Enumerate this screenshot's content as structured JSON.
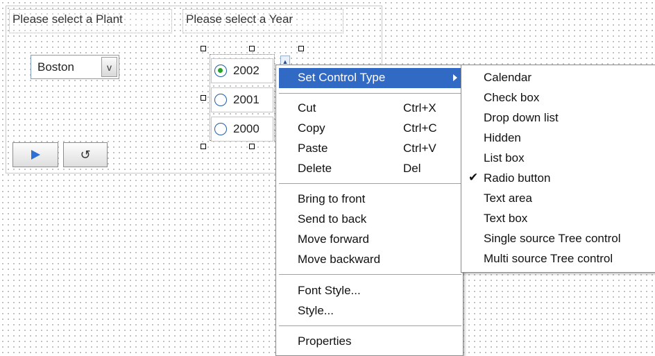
{
  "prompts": {
    "plant_label": "Please select a Plant",
    "year_label": "Please select a Year",
    "plant_select": {
      "value": "Boston",
      "arrow": "v"
    },
    "year_options": [
      {
        "label": "2002",
        "checked": true
      },
      {
        "label": "2001",
        "checked": false
      },
      {
        "label": "2000",
        "checked": false
      }
    ],
    "run_icon": "play-icon",
    "reset_icon": "reset-icon",
    "reset_glyph": "↺"
  },
  "context_menu": {
    "items": [
      {
        "label": "Set Control Type",
        "shortcut": "",
        "submenu": true,
        "highlighted": true
      },
      {
        "label": "Cut",
        "shortcut": "Ctrl+X"
      },
      {
        "label": "Copy",
        "shortcut": "Ctrl+C"
      },
      {
        "label": "Paste",
        "shortcut": "Ctrl+V"
      },
      {
        "label": "Delete",
        "shortcut": "Del"
      },
      {
        "label": "Bring to front",
        "shortcut": ""
      },
      {
        "label": "Send to back",
        "shortcut": ""
      },
      {
        "label": "Move forward",
        "shortcut": ""
      },
      {
        "label": "Move backward",
        "shortcut": ""
      },
      {
        "label": "Font Style...",
        "shortcut": ""
      },
      {
        "label": "Style...",
        "shortcut": ""
      },
      {
        "label": "Properties",
        "shortcut": ""
      }
    ]
  },
  "control_type_submenu": {
    "items": [
      {
        "label": "Calendar",
        "checked": false
      },
      {
        "label": "Check box",
        "checked": false
      },
      {
        "label": "Drop down list",
        "checked": false
      },
      {
        "label": "Hidden",
        "checked": false
      },
      {
        "label": "List box",
        "checked": false
      },
      {
        "label": "Radio button",
        "checked": true
      },
      {
        "label": "Text area",
        "checked": false
      },
      {
        "label": "Text box",
        "checked": false
      },
      {
        "label": "Single source Tree control",
        "checked": false
      },
      {
        "label": "Multi source Tree control",
        "checked": false
      }
    ],
    "check_glyph": "✔"
  },
  "colors": {
    "highlight": "#316ac5",
    "radio_checked": "#2ba02b",
    "run_icon": "#2d6fd2"
  }
}
